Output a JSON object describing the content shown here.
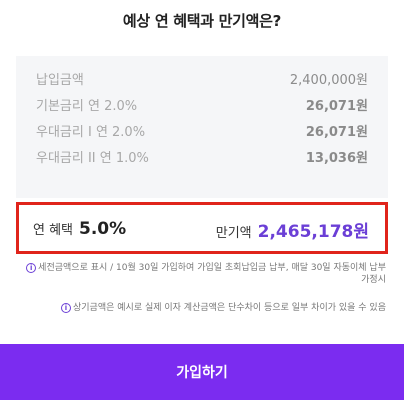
{
  "title": "예상 연 혜택과 만기액은?",
  "breakdown": [
    {
      "label": "납입금액",
      "value": "2,400,000원"
    },
    {
      "label": "기본금리 연 2.0%",
      "value": "26,071원"
    },
    {
      "label": "우대금리 I 연 2.0%",
      "value": "26,071원"
    },
    {
      "label": "우대금리 II 연 1.0%",
      "value": "13,036원"
    }
  ],
  "summary": {
    "rate_label": "연 혜택",
    "rate_value": "5.0%",
    "maturity_label": "만기액",
    "maturity_value": "2,465,178원"
  },
  "notes": [
    {
      "icon": "info-icon",
      "text": "세전금액으로 표시 / 10월 30일 가입하여 가입일 초회납입금 납부, 매달 30일 자동이체 납부 가정시"
    },
    {
      "icon": "info-icon",
      "text": "상기금액은 예시로 실제 이자 계산금액은 단수차이 등으로 일부 차이가 있을 수 있음"
    }
  ],
  "cta": {
    "label": "가입하기"
  },
  "colors": {
    "accent": "#7b2cf0",
    "highlight_border": "#e0241b",
    "maturity_text": "#6b3fd6"
  }
}
